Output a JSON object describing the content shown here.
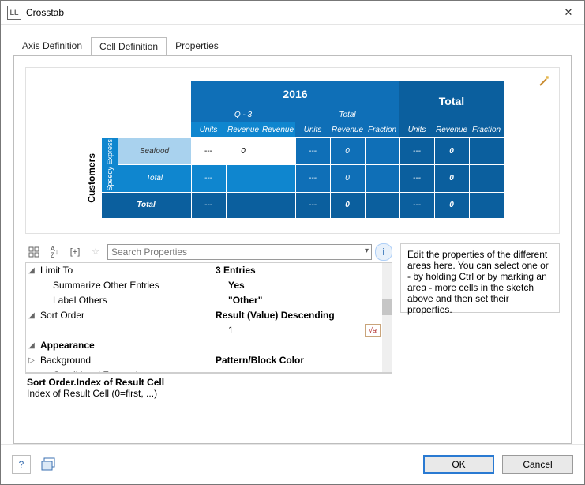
{
  "window": {
    "title": "Crosstab",
    "icon_label": "LL"
  },
  "tabs": [
    {
      "label": "Axis Definition",
      "active": false
    },
    {
      "label": "Cell Definition",
      "active": true
    },
    {
      "label": "Properties",
      "active": false
    }
  ],
  "crosstab": {
    "row_axis_title": "Customers",
    "col_groups": {
      "year": "2016",
      "total": "Total"
    },
    "sub_headers": {
      "q": "Q - 3",
      "qtotal": "Total"
    },
    "measure_headers": [
      "Units",
      "Revenue",
      "Revenue",
      "Units",
      "Revenue",
      "Fraction",
      "Units",
      "Revenue",
      "Fraction"
    ],
    "side_col": "Speedy Express",
    "row_labels": [
      "Seafood",
      "Total",
      "Total"
    ],
    "dash": "---",
    "zero": "0",
    "zero_i": "0"
  },
  "toolbar": {
    "search_placeholder": "Search Properties",
    "btn_categorized": "⊞",
    "btn_sort": "A↓",
    "btn_expand": "[+]",
    "btn_star": "☆"
  },
  "propgrid": {
    "rows": [
      {
        "exp": "◢",
        "indent": 0,
        "name": "Limit To",
        "value": "3 Entries",
        "bold": true,
        "cat": false,
        "sel": false
      },
      {
        "exp": "",
        "indent": 1,
        "name": "Summarize Other Entries",
        "value": "Yes",
        "bold": true,
        "cat": false,
        "sel": false
      },
      {
        "exp": "",
        "indent": 1,
        "name": "Label Others",
        "value": "\"Other\"",
        "bold": true,
        "cat": false,
        "sel": false
      },
      {
        "exp": "◢",
        "indent": 0,
        "name": "Sort Order",
        "value": "Result (Value) Descending",
        "bold": true,
        "cat": false,
        "sel": false
      },
      {
        "exp": "",
        "indent": 1,
        "name": "Index of Result Cell",
        "value": "1",
        "bold": false,
        "cat": false,
        "sel": true,
        "fx": true
      },
      {
        "exp": "◢",
        "indent": 0,
        "name": "Appearance",
        "value": "",
        "bold": true,
        "cat": true,
        "sel": false
      },
      {
        "exp": "▷",
        "indent": 0,
        "name": "Background",
        "value": "Pattern/Block Color",
        "bold": true,
        "cat": false,
        "sel": false
      },
      {
        "exp": "",
        "indent": 1,
        "name": "Conditional Formatting",
        "value": "<not set>",
        "bold": false,
        "cat": false,
        "sel": false
      }
    ],
    "help_title": "Sort Order.Index of Result Cell",
    "help_desc": "Index of Result Cell (0=first, ...)"
  },
  "hint": "Edit the properties of the different areas here. You can select one or - by holding Ctrl or by marking an area - more cells in the sketch above and then set their properties.",
  "footer": {
    "ok": "OK",
    "cancel": "Cancel"
  }
}
